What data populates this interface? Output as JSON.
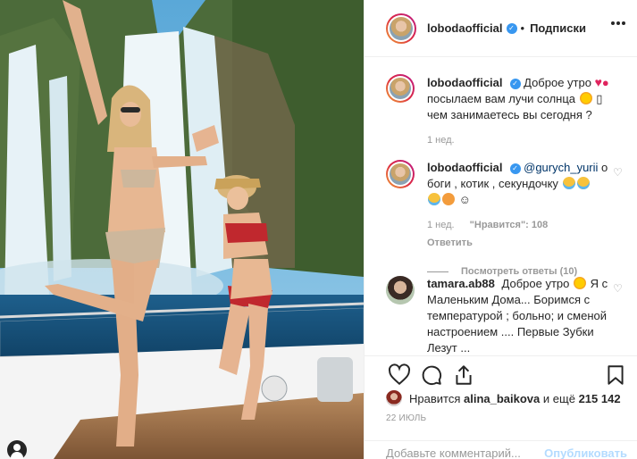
{
  "post": {
    "photo_alt": "",
    "author": "lobodaofficial",
    "separator": "•",
    "follow_label": "Подписки"
  },
  "comments": [
    {
      "user": "lobodaofficial",
      "text": "Доброе утро",
      "emoji_after_first": "❤️🎈",
      "text_line2": "посылаем вам лучи солнца",
      "text_line3": "чем занимаетесь вы сегодня ?",
      "time": "1 нед."
    },
    {
      "user": "lobodaofficial",
      "mention": "@gurych_yurii",
      "text": "о боги , котик , секундочку",
      "time": "1 нед.",
      "likes_label": "\"Нравится\": 108",
      "reply_label": "Ответить",
      "view_replies": "Посмотреть ответы (10)"
    },
    {
      "user": "tamara.ab88",
      "text": "Доброе утро",
      "text_cont": "Я с Маленьким Дома... Боримся с температурой ; больно; и сменой настроением .... Первые Зубки Лезут ...",
      "emoji": "☀️"
    }
  ],
  "actions": {
    "liked_prefix": "Нравится",
    "liked_user": "alina_baikova",
    "liked_and": "и ещё",
    "liked_count": "215 142",
    "date": "22 ИЮЛЬ",
    "comment_placeholder": "Добавьте комментарий...",
    "publish_label": "Опубликовать"
  },
  "icons": {
    "header_more": "more-options-icon",
    "like": "heart-icon",
    "comment": "comment-icon",
    "share": "share-icon",
    "save": "bookmark-icon",
    "verified": "verified-badge-icon"
  },
  "colors": {
    "link": "#003569",
    "verified": "#3897f0",
    "muted": "#999999",
    "publish_disabled": "#b3dbff"
  }
}
